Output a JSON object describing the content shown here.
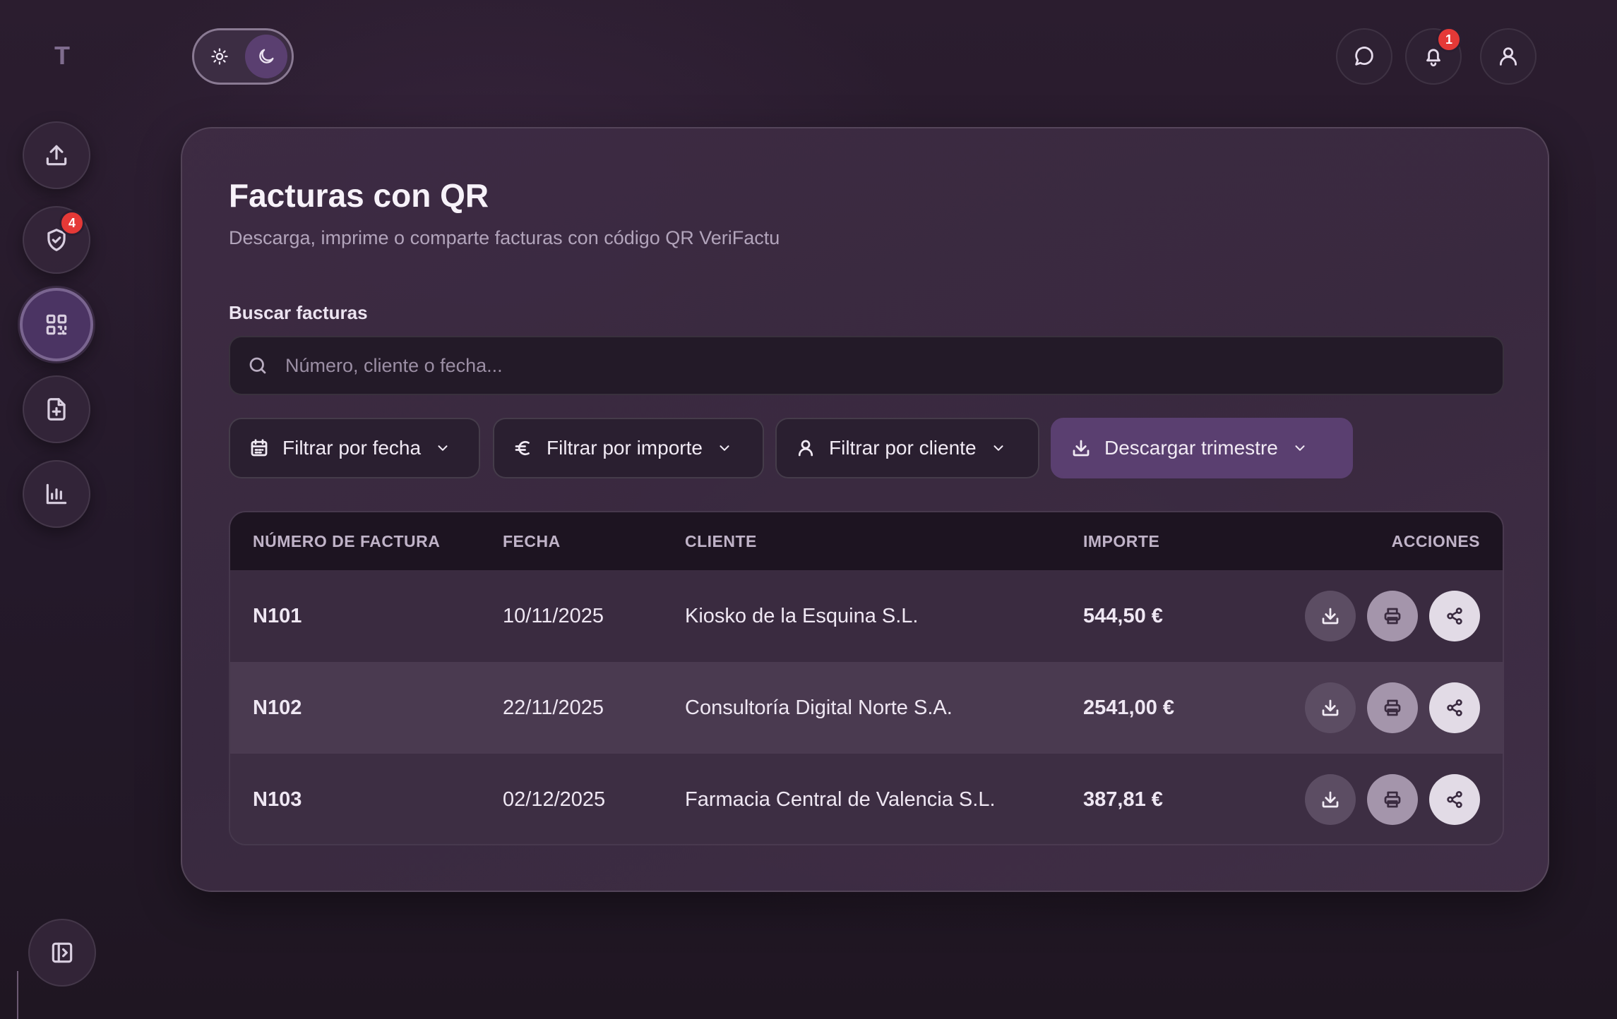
{
  "app": {
    "logo_letter": "T"
  },
  "sidebar": {
    "items": [
      {
        "name": "upload",
        "icon": "upload-icon",
        "active": false
      },
      {
        "name": "verify",
        "icon": "shield-check-icon",
        "active": false,
        "badge": "4"
      },
      {
        "name": "qr-invoices",
        "icon": "qr-code-icon",
        "active": true
      },
      {
        "name": "new-invoice",
        "icon": "file-plus-icon",
        "active": false
      },
      {
        "name": "reports",
        "icon": "bar-chart-icon",
        "active": false
      }
    ],
    "collapse_icon": "sidebar-toggle-icon"
  },
  "theme_toggle": {
    "options": [
      "light",
      "dark"
    ],
    "selected": "dark"
  },
  "header": {
    "notifications_badge": "1",
    "icons": [
      "chat-icon",
      "bell-icon",
      "user-icon"
    ]
  },
  "main": {
    "title": "Facturas con QR",
    "subtitle": "Descarga, imprime o comparte facturas con código QR VeriFactu",
    "search": {
      "label": "Buscar facturas",
      "placeholder": "Número, cliente o fecha...",
      "value": ""
    },
    "filters": {
      "date": "Filtrar por fecha",
      "amount": "Filtrar por importe",
      "client": "Filtrar por cliente",
      "download": "Descargar trimestre"
    },
    "table": {
      "headers": {
        "number": "NÚMERO DE FACTURA",
        "date": "FECHA",
        "client": "CLIENTE",
        "amount": "IMPORTE",
        "actions": "ACCIONES"
      },
      "rows": [
        {
          "number": "N101",
          "date": "10/11/2025",
          "client": "Kiosko de la Esquina S.L.",
          "amount": "544,50 €"
        },
        {
          "number": "N102",
          "date": "22/11/2025",
          "client": "Consultoría Digital Norte S.A.",
          "amount": "2541,00 €"
        },
        {
          "number": "N103",
          "date": "02/12/2025",
          "client": "Farmacia Central de Valencia S.L.",
          "amount": "387,81 €"
        }
      ]
    }
  },
  "colors": {
    "accent": "#5a3f70",
    "badge": "#e53937",
    "background": "#24192a"
  }
}
